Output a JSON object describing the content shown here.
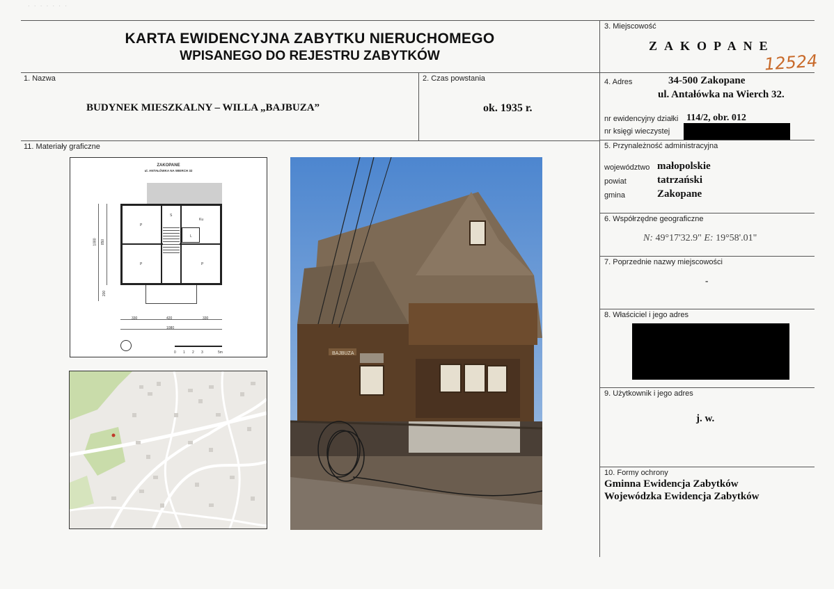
{
  "header": {
    "title_line1": "KARTA EWIDENCYJNA ZABYTKU NIERUCHOMEGO",
    "title_line2": "WPISANEGO DO REJESTRU ZABYTKÓW"
  },
  "handwritten_number": "12524",
  "fields": {
    "f1": {
      "label": "1. Nazwa",
      "value": "BUDYNEK MIESZKALNY – WILLA „BAJBUZA”"
    },
    "f2": {
      "label": "2. Czas powstania",
      "value": "ok. 1935 r."
    },
    "f3": {
      "label": "3. Miejscowość",
      "value": "ZAKOPANE"
    },
    "f4": {
      "label": "4. Adres",
      "line1": "34-500 Zakopane",
      "line2": "ul. Antałówka na Wierch 32.",
      "parcel_label": "nr ewidencyjny działki",
      "parcel_value": "114/2, obr. 012",
      "book_label": "nr księgi wieczystej"
    },
    "f5": {
      "label": "5. Przynależność administracyjna",
      "voivodeship_label": "województwo",
      "voivodeship_value": "małopolskie",
      "county_label": "powiat",
      "county_value": "tatrzański",
      "commune_label": "gmina",
      "commune_value": "Zakopane"
    },
    "f6": {
      "label": "6. Współrzędne geograficzne",
      "n_label": "N:",
      "n_value": "49°17'32.9\"",
      "e_label": "E:",
      "e_value": "19°58'.01\""
    },
    "f7": {
      "label": "7. Poprzednie nazwy miejscowości",
      "value": "-"
    },
    "f8": {
      "label": "8. Właściciel i jego adres"
    },
    "f9": {
      "label": "9. Użytkownik i jego adres",
      "value": "j. w."
    },
    "f10": {
      "label": "10. Formy ochrony",
      "line1": "Gminna Ewidencja Zabytków",
      "line2": "Wojewódzka Ewidencja Zabytków"
    },
    "f11": {
      "label": "11. Materiały graficzne"
    }
  },
  "floorplan": {
    "title": "ZAKOPANE",
    "subtitle": "ul. ANTAŁÓWKA NA WIERCH 32",
    "dims_top": [
      "330",
      "420",
      "330"
    ],
    "dim_total": "1080",
    "dims_side": [
      "1080",
      "850",
      "200"
    ],
    "rooms": [
      "P",
      "S",
      "Ku",
      "L",
      "P",
      "P"
    ],
    "scale_ticks": [
      "0",
      "1",
      "2",
      "3",
      "5m"
    ]
  },
  "photo_sign": "BAJBUZA",
  "colors": {
    "sky": "#5b8fd0",
    "wood": "#5a3e26",
    "roof": "#7d6a55",
    "map_bg": "#eceae6",
    "map_green": "#c9dcaa",
    "handwriting": "#c86a2a"
  }
}
